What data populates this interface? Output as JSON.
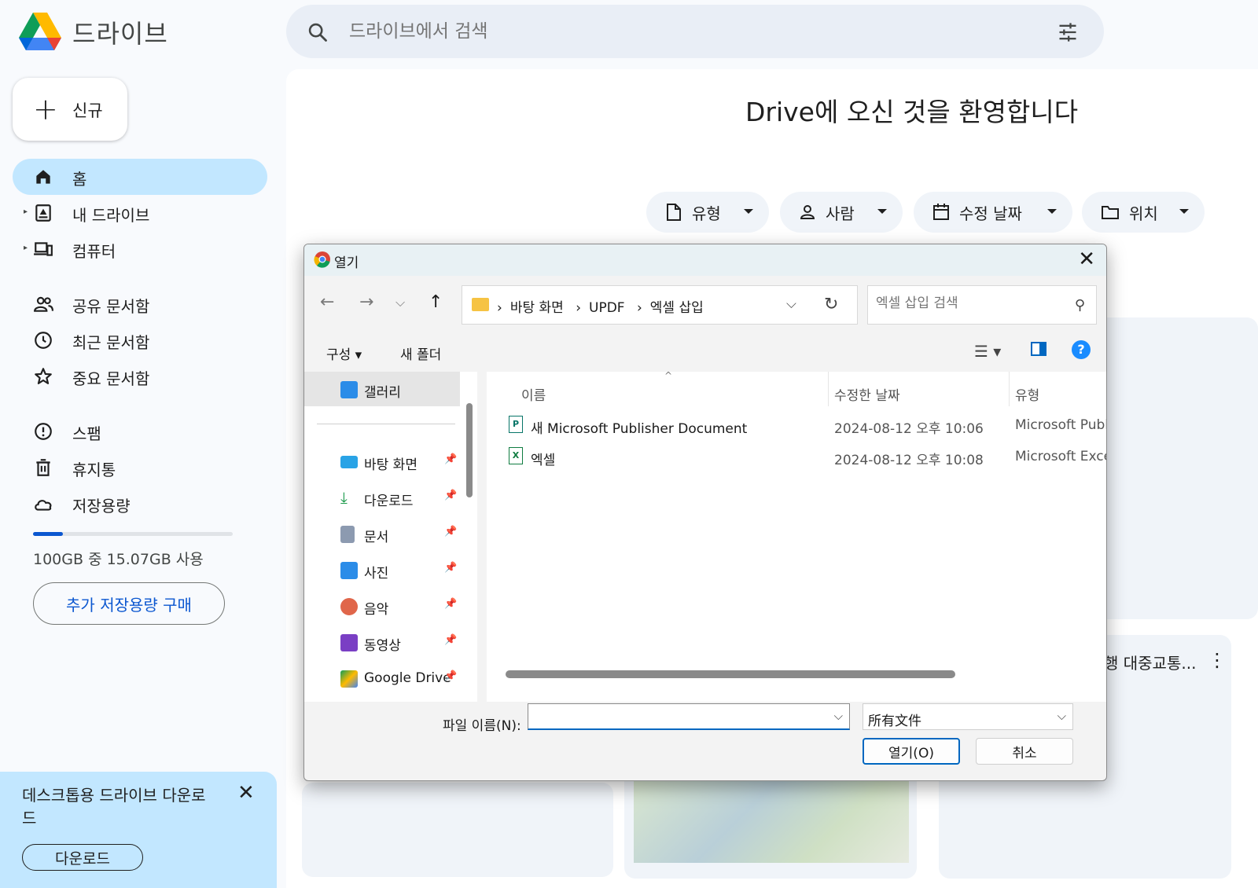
{
  "app": {
    "brand": "드라이브"
  },
  "search": {
    "placeholder": "드라이브에서 검색"
  },
  "sidebar": {
    "new_label": "신규",
    "items": [
      {
        "label": "홈",
        "icon": "home-icon"
      },
      {
        "label": "내 드라이브",
        "icon": "my-drive-icon"
      },
      {
        "label": "컴퓨터",
        "icon": "computer-icon"
      },
      {
        "label": "공유 문서함",
        "icon": "people-icon"
      },
      {
        "label": "최근 문서함",
        "icon": "clock-icon"
      },
      {
        "label": "중요 문서함",
        "icon": "star-icon"
      },
      {
        "label": "스팸",
        "icon": "spam-icon"
      },
      {
        "label": "휴지통",
        "icon": "trash-icon"
      },
      {
        "label": "저장용량",
        "icon": "cloud-icon"
      }
    ],
    "storage_text": "100GB 중 15.07GB 사용",
    "storage_fraction": 0.15,
    "buy_label": "추가 저장용량 구매"
  },
  "promo": {
    "text": "데스크톱용 드라이브 다운로드",
    "button": "다운로드",
    "close": "✕"
  },
  "main": {
    "welcome": "Drive에 오신 것을 환영합니다",
    "filters": [
      {
        "label": "유형",
        "icon": "file-icon"
      },
      {
        "label": "사람",
        "icon": "person-icon"
      },
      {
        "label": "수정 날짜",
        "icon": "calendar-icon"
      },
      {
        "label": "위치",
        "icon": "folder-icon"
      }
    ],
    "card_title": "행 대중교통..."
  },
  "dialog": {
    "title": "열기",
    "close": "✕",
    "breadcrumb": [
      "바탕 화면",
      "UPDF",
      "엑셀 삽입"
    ],
    "search_placeholder": "엑셀 삽입 검색",
    "organize": "구성 ▾",
    "new_folder": "새 폴더",
    "nav": [
      {
        "label": "갤러리",
        "pinned": false
      },
      {
        "label": "바탕 화면",
        "pinned": true
      },
      {
        "label": "다운로드",
        "pinned": true
      },
      {
        "label": "문서",
        "pinned": true
      },
      {
        "label": "사진",
        "pinned": true
      },
      {
        "label": "음악",
        "pinned": true
      },
      {
        "label": "동영상",
        "pinned": true
      },
      {
        "label": "Google Drive",
        "pinned": true
      }
    ],
    "columns": {
      "name": "이름",
      "modified": "수정한 날짜",
      "type": "유형"
    },
    "files": [
      {
        "name": "새 Microsoft Publisher Document",
        "modified": "2024-08-12 오후 10:06",
        "type": "Microsoft Publisher",
        "icon": "publisher-icon"
      },
      {
        "name": "엑셀",
        "modified": "2024-08-12 오후 10:08",
        "type": "Microsoft Excel",
        "icon": "excel-icon"
      }
    ],
    "filename_label": "파일 이름(N):",
    "filename_value": "",
    "filetype": "所有文件",
    "open_label": "열기(O)",
    "cancel_label": "취소"
  }
}
